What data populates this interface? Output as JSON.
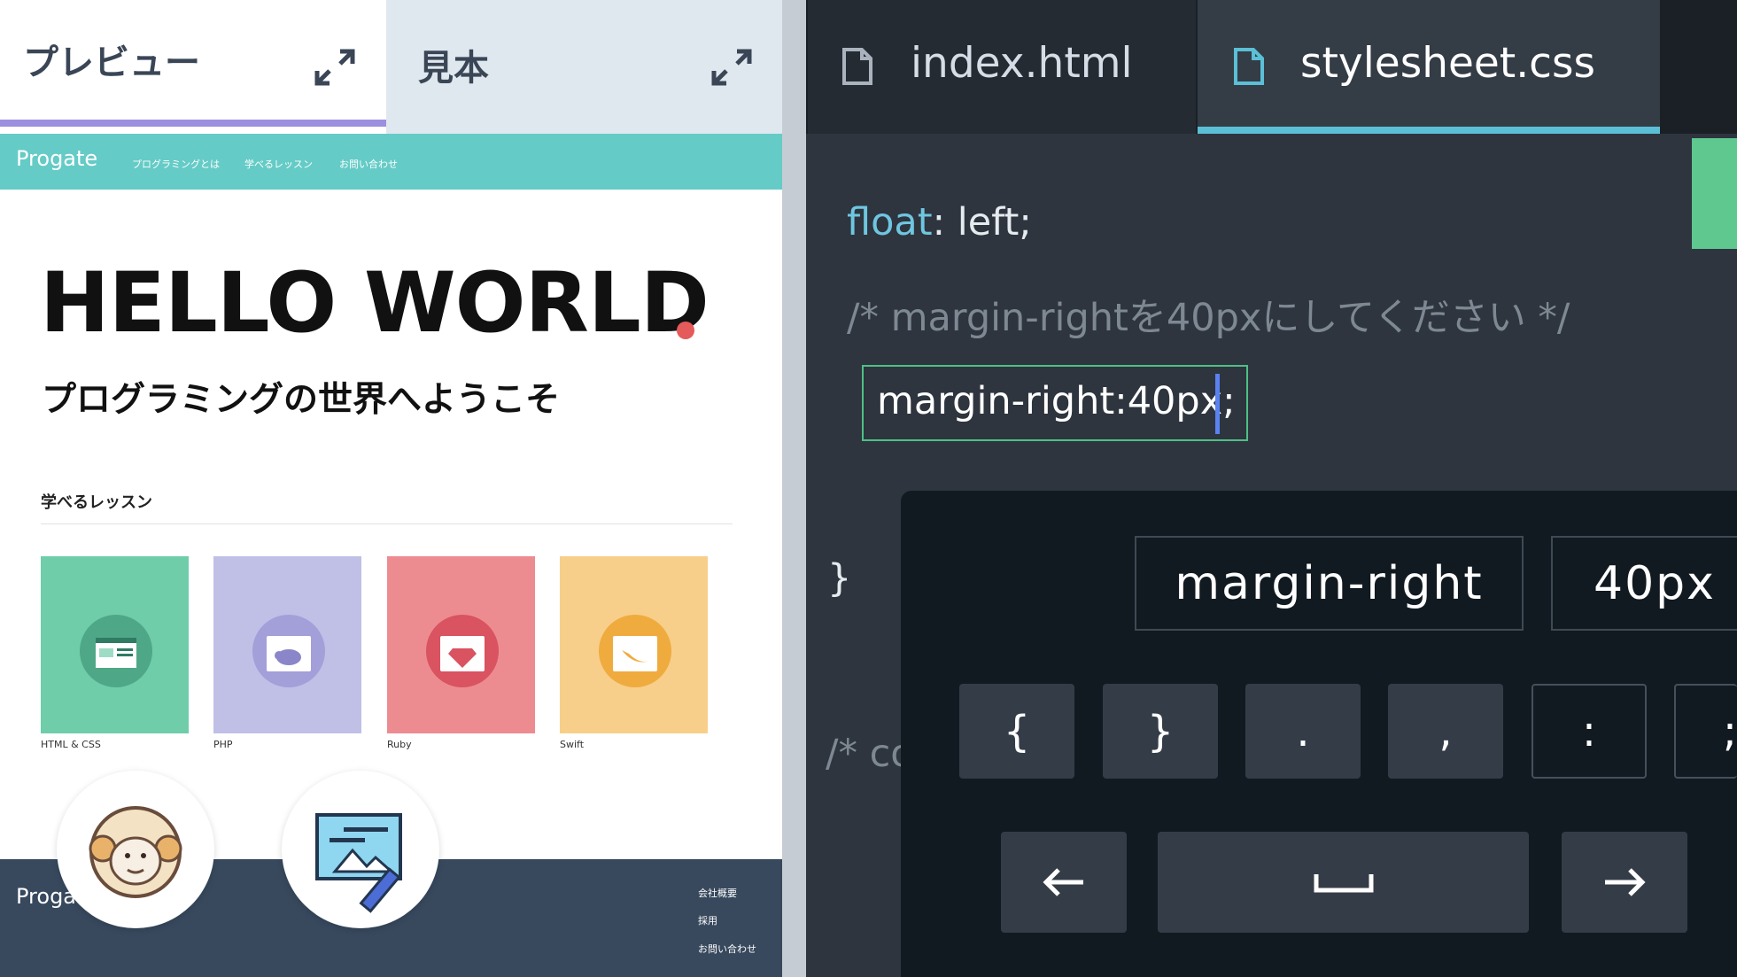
{
  "preview": {
    "tabs": {
      "preview": "プレビュー",
      "sample": "見本"
    },
    "site": {
      "logo": "Progate",
      "nav": [
        "プログラミングとは",
        "学べるレッスン",
        "お問い合わせ"
      ],
      "hero_title": "HELLO WORLD",
      "hero_subtitle": "プログラミングの世界へようこそ",
      "lessons_heading": "学べるレッスン",
      "lessons": [
        {
          "label": "HTML & CSS",
          "color": "#6fcdaa"
        },
        {
          "label": "PHP",
          "color": "#c0bfe6"
        },
        {
          "label": "Ruby",
          "color": "#ec8c91"
        },
        {
          "label": "Swift",
          "color": "#f7cf8a"
        }
      ],
      "footer_logo": "Progate",
      "footer_links": [
        "会社概要",
        "採用",
        "お問い合わせ"
      ]
    }
  },
  "editor": {
    "tabs": [
      {
        "label": "index.html",
        "active": false
      },
      {
        "label": "stylesheet.css",
        "active": true
      }
    ],
    "code": {
      "prop": "float",
      "prop_rest": ": left;",
      "comment": "/* margin-rightを40pxにしてください */",
      "input_value": "margin-right:40px;",
      "close_brace": "}",
      "comment2": "/* co"
    },
    "keyboard": {
      "suggestions": [
        "margin-right",
        "40px"
      ],
      "symbols": [
        "{",
        "}",
        ".",
        ",",
        ":",
        ";"
      ],
      "left_arrow": "←",
      "space": "␣",
      "right_arrow": "→"
    }
  },
  "colors": {
    "accent_teal": "#65cbc6",
    "footer": "#38495e",
    "editor_bg": "#2e353e",
    "tab_underline": "#5bbfd6"
  }
}
